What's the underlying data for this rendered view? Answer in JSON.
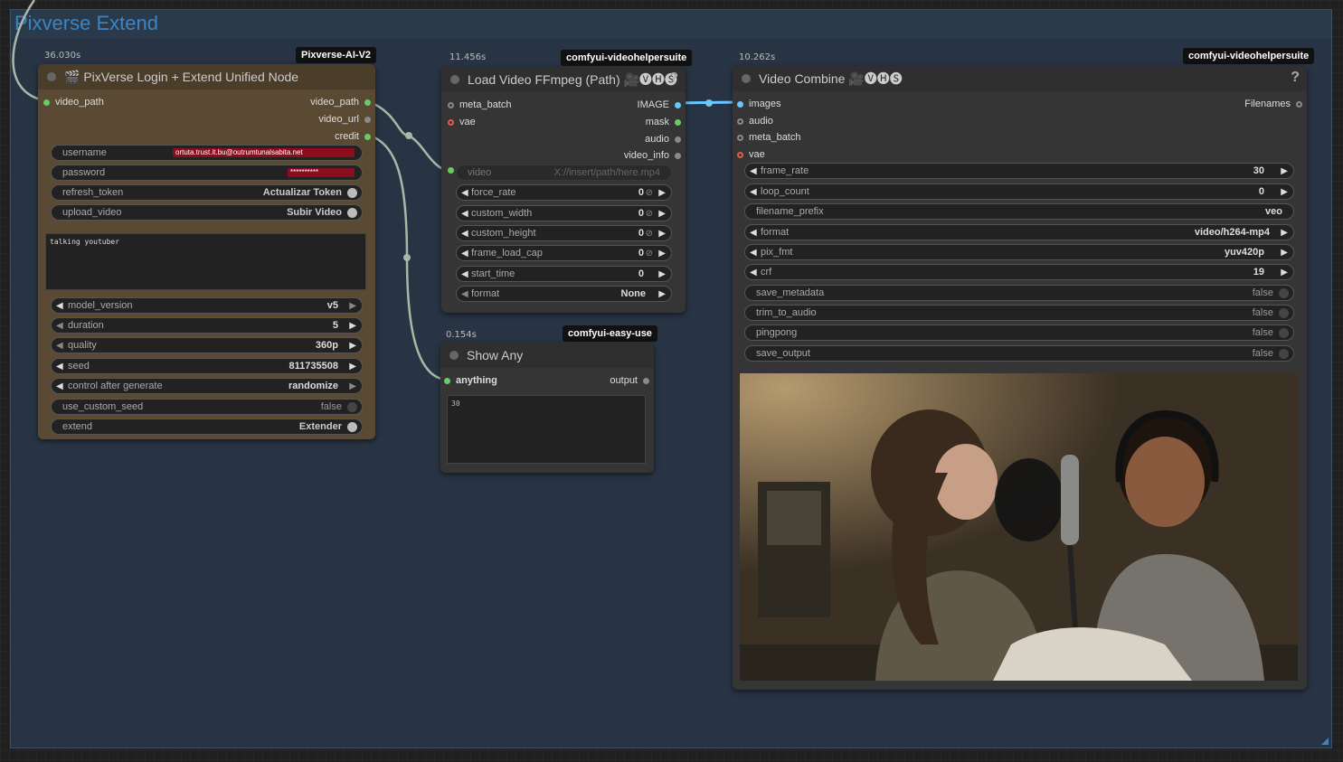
{
  "group": {
    "title": "Pixverse Extend"
  },
  "node1": {
    "timing": "36.030s",
    "badge": "Pixverse-AI-V2",
    "title": "🎬 PixVerse Login + Extend Unified Node",
    "inputs": [
      "video_path"
    ],
    "outputs": [
      "video_path",
      "video_url",
      "credit"
    ],
    "username_label": "username",
    "username_value": "ortuta.trust.it.bu@outrumtunalsabita.net",
    "password_label": "password",
    "password_value": "**********",
    "refresh_label": "refresh_token",
    "refresh_value": "Actualizar Token",
    "upload_label": "upload_video",
    "upload_value": "Subir Video",
    "prompt": "talking youtuber",
    "widgets": [
      {
        "label": "model_version",
        "value": "v5"
      },
      {
        "label": "duration",
        "value": "5"
      },
      {
        "label": "quality",
        "value": "360p"
      },
      {
        "label": "seed",
        "value": "811735508"
      },
      {
        "label": "control after generate",
        "value": "randomize"
      }
    ],
    "use_custom_seed_label": "use_custom_seed",
    "use_custom_seed_value": "false",
    "extend_label": "extend",
    "extend_value": "Extender"
  },
  "node2": {
    "timing": "11.456s",
    "badge": "comfyui-videohelpersuite",
    "title": "Load Video FFmpeg (Path) 🎥🅥🅗🅢",
    "inputs": [
      "meta_batch",
      "vae"
    ],
    "outputs": [
      "IMAGE",
      "mask",
      "audio",
      "video_info"
    ],
    "video_label": "video",
    "video_placeholder": "X://insert/path/here.mp4",
    "widgets": [
      {
        "label": "force_rate",
        "value": "0"
      },
      {
        "label": "custom_width",
        "value": "0"
      },
      {
        "label": "custom_height",
        "value": "0"
      },
      {
        "label": "frame_load_cap",
        "value": "0"
      },
      {
        "label": "start_time",
        "value": "0"
      },
      {
        "label": "format",
        "value": "None"
      }
    ]
  },
  "node3": {
    "timing": "0.154s",
    "badge": "comfyui-easy-use",
    "title": "Show Any",
    "input": "anything",
    "output": "output",
    "text": "30"
  },
  "node4": {
    "timing": "10.262s",
    "badge": "comfyui-videohelpersuite",
    "title": "Video Combine 🎥🅥🅗🅢",
    "inputs": [
      "images",
      "audio",
      "meta_batch",
      "vae"
    ],
    "output": "Filenames",
    "widgets": [
      {
        "label": "frame_rate",
        "value": "30"
      },
      {
        "label": "loop_count",
        "value": "0"
      },
      {
        "label": "filename_prefix",
        "value": "veo"
      },
      {
        "label": "format",
        "value": "video/h264-mp4"
      },
      {
        "label": "pix_fmt",
        "value": "yuv420p"
      },
      {
        "label": "crf",
        "value": "19"
      }
    ],
    "toggles": [
      {
        "label": "save_metadata",
        "value": "false"
      },
      {
        "label": "trim_to_audio",
        "value": "false"
      },
      {
        "label": "pingpong",
        "value": "false"
      },
      {
        "label": "save_output",
        "value": "false"
      }
    ]
  },
  "colors": {
    "group_bg": "#283443",
    "group_title": "#3a85c2",
    "node1_bg": "#5b4a33",
    "node_bg": "#353535",
    "wire": "#a8b8a8",
    "image_wire": "#6ac6ff"
  }
}
